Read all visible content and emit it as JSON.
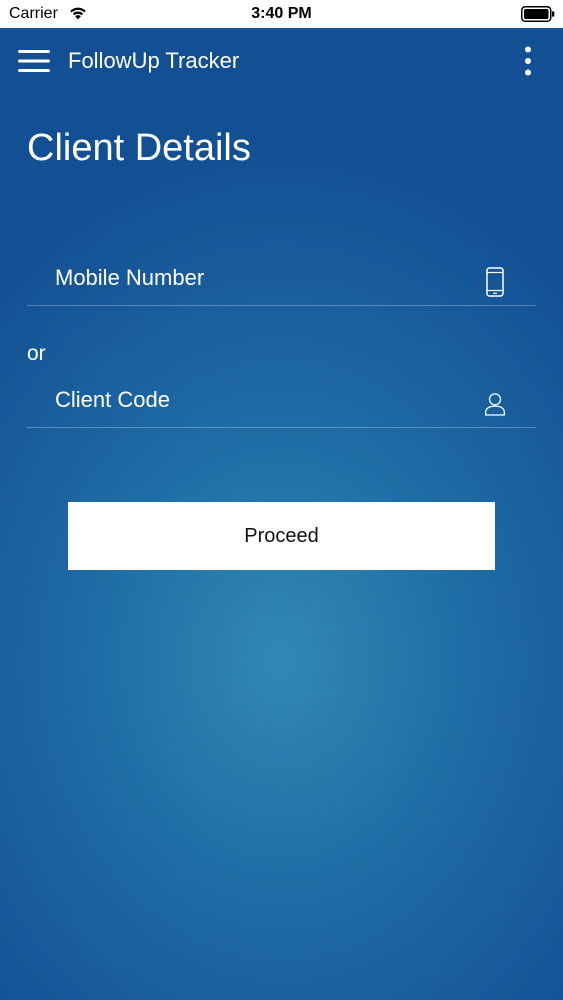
{
  "status_bar": {
    "carrier": "Carrier",
    "time": "3:40 PM"
  },
  "app_bar": {
    "title": "FollowUp Tracker"
  },
  "page": {
    "title": "Client Details",
    "or_label": "or"
  },
  "form": {
    "mobile_placeholder": "Mobile Number",
    "mobile_value": "",
    "code_placeholder": "Client Code",
    "code_value": "",
    "proceed_label": "Proceed"
  },
  "icons": {
    "menu": "hamburger-menu-icon",
    "more": "more-vertical-icon",
    "mobile": "mobile-phone-icon",
    "code": "user-icon",
    "wifi": "wifi-icon",
    "battery": "battery-icon"
  },
  "colors": {
    "background_center": "#3189b4",
    "background_edge": "#134f93",
    "text": "#ffffff",
    "button_bg": "#ffffff",
    "button_text": "#111111"
  }
}
